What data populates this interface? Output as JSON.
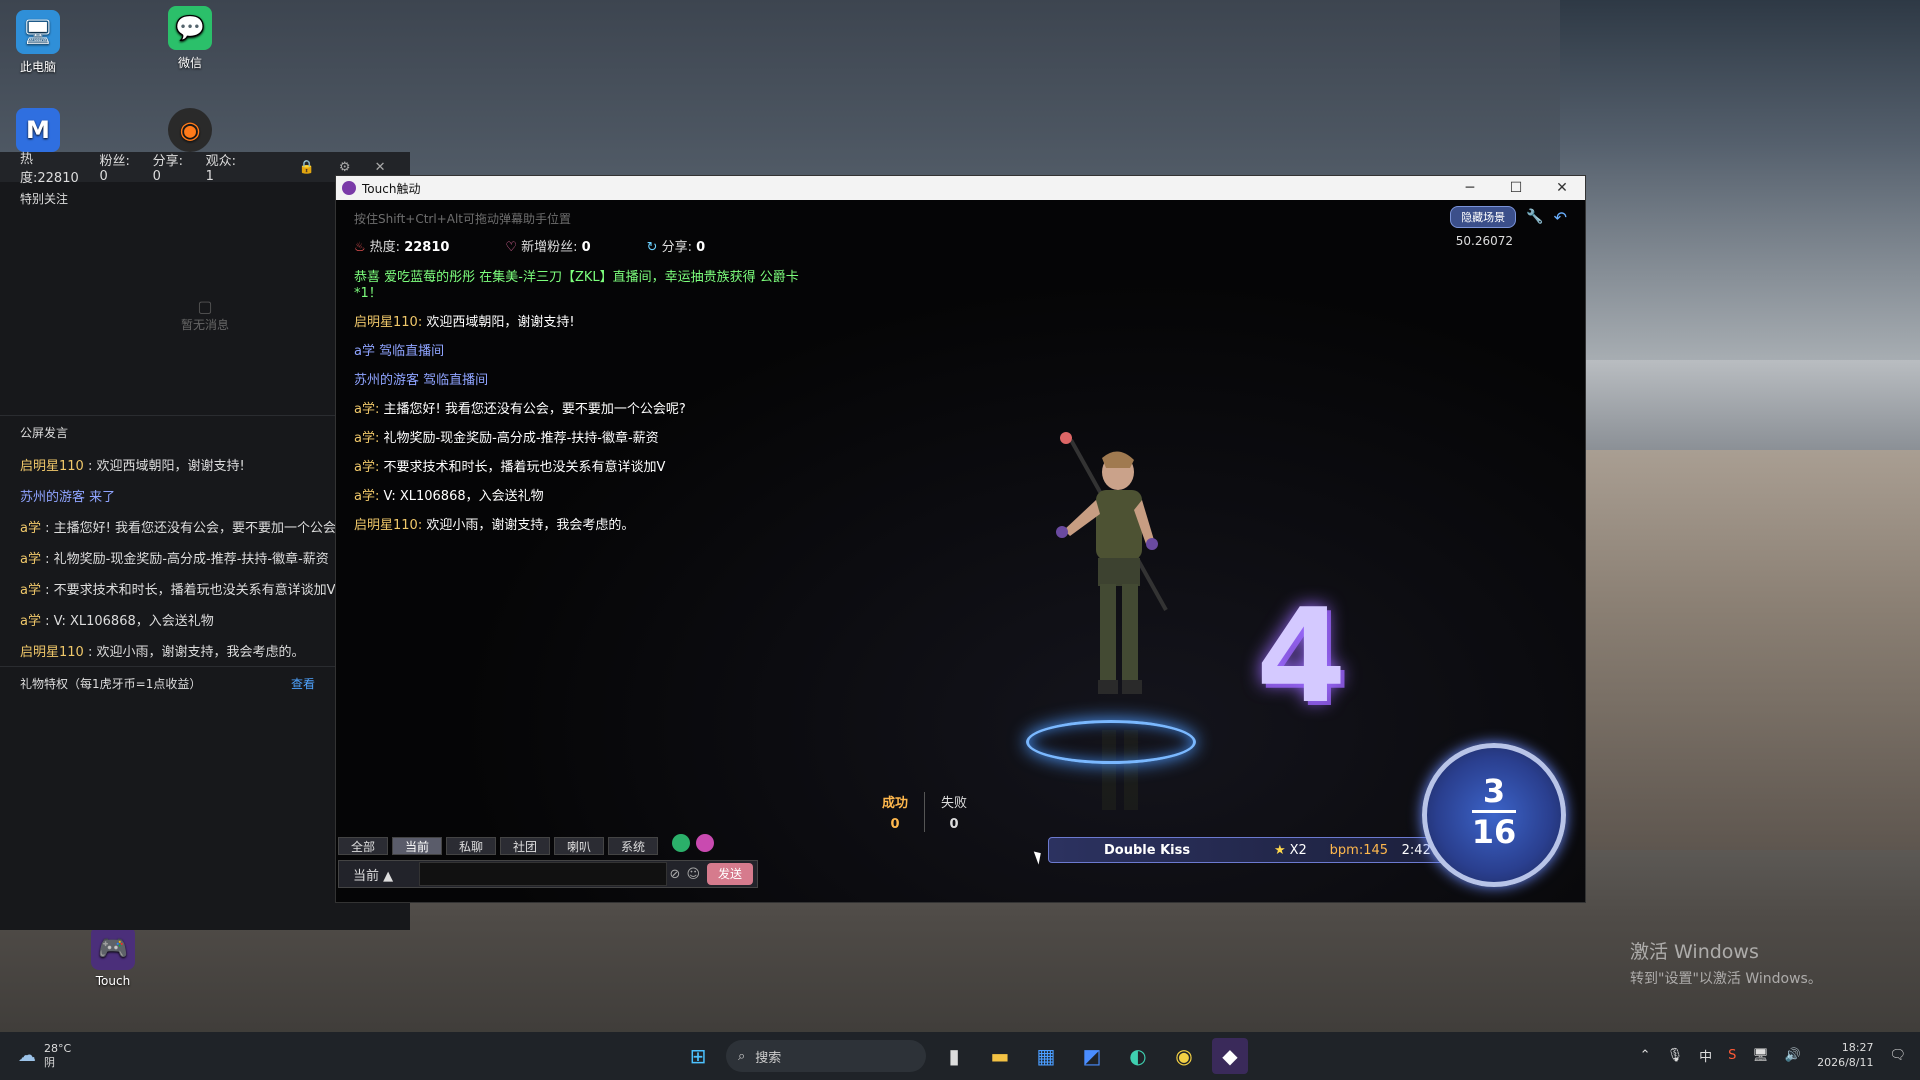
{
  "desktop": {
    "icons": [
      {
        "label": "此电脑",
        "glyph": "🖥"
      },
      {
        "label": "微信",
        "glyph": "💬"
      },
      {
        "label": "",
        "glyph": "M"
      },
      {
        "label": "",
        "glyph": "◉"
      },
      {
        "label": "Touch",
        "glyph": "🎮"
      }
    ],
    "watermark_line1": "激活 Windows",
    "watermark_line2": "转到\"设置\"以激活 Windows。"
  },
  "assistant": {
    "stats": {
      "heat_label": "热度:",
      "heat_value": "22810",
      "fans_label": "粉丝:",
      "fans_value": "0",
      "share_label": "分享:",
      "share_value": "0",
      "viewers_label": "观众:",
      "viewers_value": "1"
    },
    "special_follow_title": "特别关注",
    "empty_text": "暂无消息",
    "public_title": "公屏发言",
    "messages": [
      {
        "nick": "启明星110",
        "sep": " : ",
        "text": "欢迎西域朝阳，谢谢支持!",
        "nick_color": "gold"
      },
      {
        "nick": "苏州的游客 来了",
        "sep": "",
        "text": "",
        "nick_color": "blue"
      },
      {
        "nick": "a学",
        "sep": " : ",
        "text": "主播您好! 我看您还没有公会，要不要加一个公会呢?",
        "nick_color": "gold"
      },
      {
        "nick": "a学",
        "sep": " : ",
        "text": "礼物奖励-现金奖励-高分成-推荐-扶持-徽章-薪资",
        "nick_color": "gold"
      },
      {
        "nick": "a学",
        "sep": " : ",
        "text": "不要求技术和时长，播着玩也没关系有意详谈加V",
        "nick_color": "gold"
      },
      {
        "nick": "a学",
        "sep": " : ",
        "text": "V: XL106868，入会送礼物",
        "nick_color": "gold"
      },
      {
        "nick": "启明星110",
        "sep": " : ",
        "text": "欢迎小雨，谢谢支持，我会考虑的。",
        "nick_color": "gold"
      }
    ],
    "gift_privilege": "礼物特权（每1虎牙币=1点收益）",
    "gift_link": "查看"
  },
  "game": {
    "window_title": "Touch触动",
    "hint": "按住Shift+Ctrl+Alt可拖动弹幕助手位置",
    "hide_scene_label": "隐藏场景",
    "timer_value": "50.26072",
    "hud": {
      "heat_label": "热度:",
      "heat_value": "22810",
      "new_fans_label": "新增粉丝:",
      "new_fans_value": "0",
      "share_label": "分享:",
      "share_value": "0"
    },
    "chat": [
      {
        "type": "system",
        "text": "恭喜 爱吃蓝莓的彤彤 在集美-洋三刀【ZKL】直播间，幸运抽贵族获得 公爵卡*1！"
      },
      {
        "type": "msg",
        "nick": "启明星110:",
        "text": " 欢迎西域朝阳，谢谢支持!"
      },
      {
        "type": "enter",
        "text": "a学 驾临直播间"
      },
      {
        "type": "enter",
        "text": "苏州的游客 驾临直播间"
      },
      {
        "type": "msg",
        "nick": "a学:",
        "text": " 主播您好! 我看您还没有公会，要不要加一个公会呢?"
      },
      {
        "type": "msg",
        "nick": "a学:",
        "text": " 礼物奖励-现金奖励-高分成-推荐-扶持-徽章-薪资"
      },
      {
        "type": "msg",
        "nick": "a学:",
        "text": " 不要求技术和时长，播着玩也没关系有意详谈加V"
      },
      {
        "type": "msg",
        "nick": "a学:",
        "text": " V: XL106868，入会送礼物"
      },
      {
        "type": "msg",
        "nick": "启明星110:",
        "text": " 欢迎小雨，谢谢支持，我会考虑的。"
      }
    ],
    "countdown": "4",
    "score": {
      "success_label": "成功",
      "success_value": "0",
      "fail_label": "失败",
      "fail_value": "0"
    },
    "tabs": [
      {
        "label": "全部",
        "active": false
      },
      {
        "label": "当前",
        "active": true
      },
      {
        "label": "私聊",
        "active": false
      },
      {
        "label": "社团",
        "active": false
      },
      {
        "label": "喇叭",
        "active": false
      },
      {
        "label": "系统",
        "active": false
      }
    ],
    "input": {
      "scope": "当前",
      "placeholder": "",
      "send_label": "发送"
    },
    "song": {
      "title": "Double Kiss",
      "multiplier": "X2",
      "bpm": "bpm:145",
      "duration": "2:42"
    },
    "progress": {
      "current": "3",
      "total": "16"
    }
  },
  "taskbar": {
    "weather_temp": "28°C",
    "weather_desc": "阴",
    "search_placeholder": "搜索",
    "time": "18:27",
    "date": "2026/8/11"
  }
}
